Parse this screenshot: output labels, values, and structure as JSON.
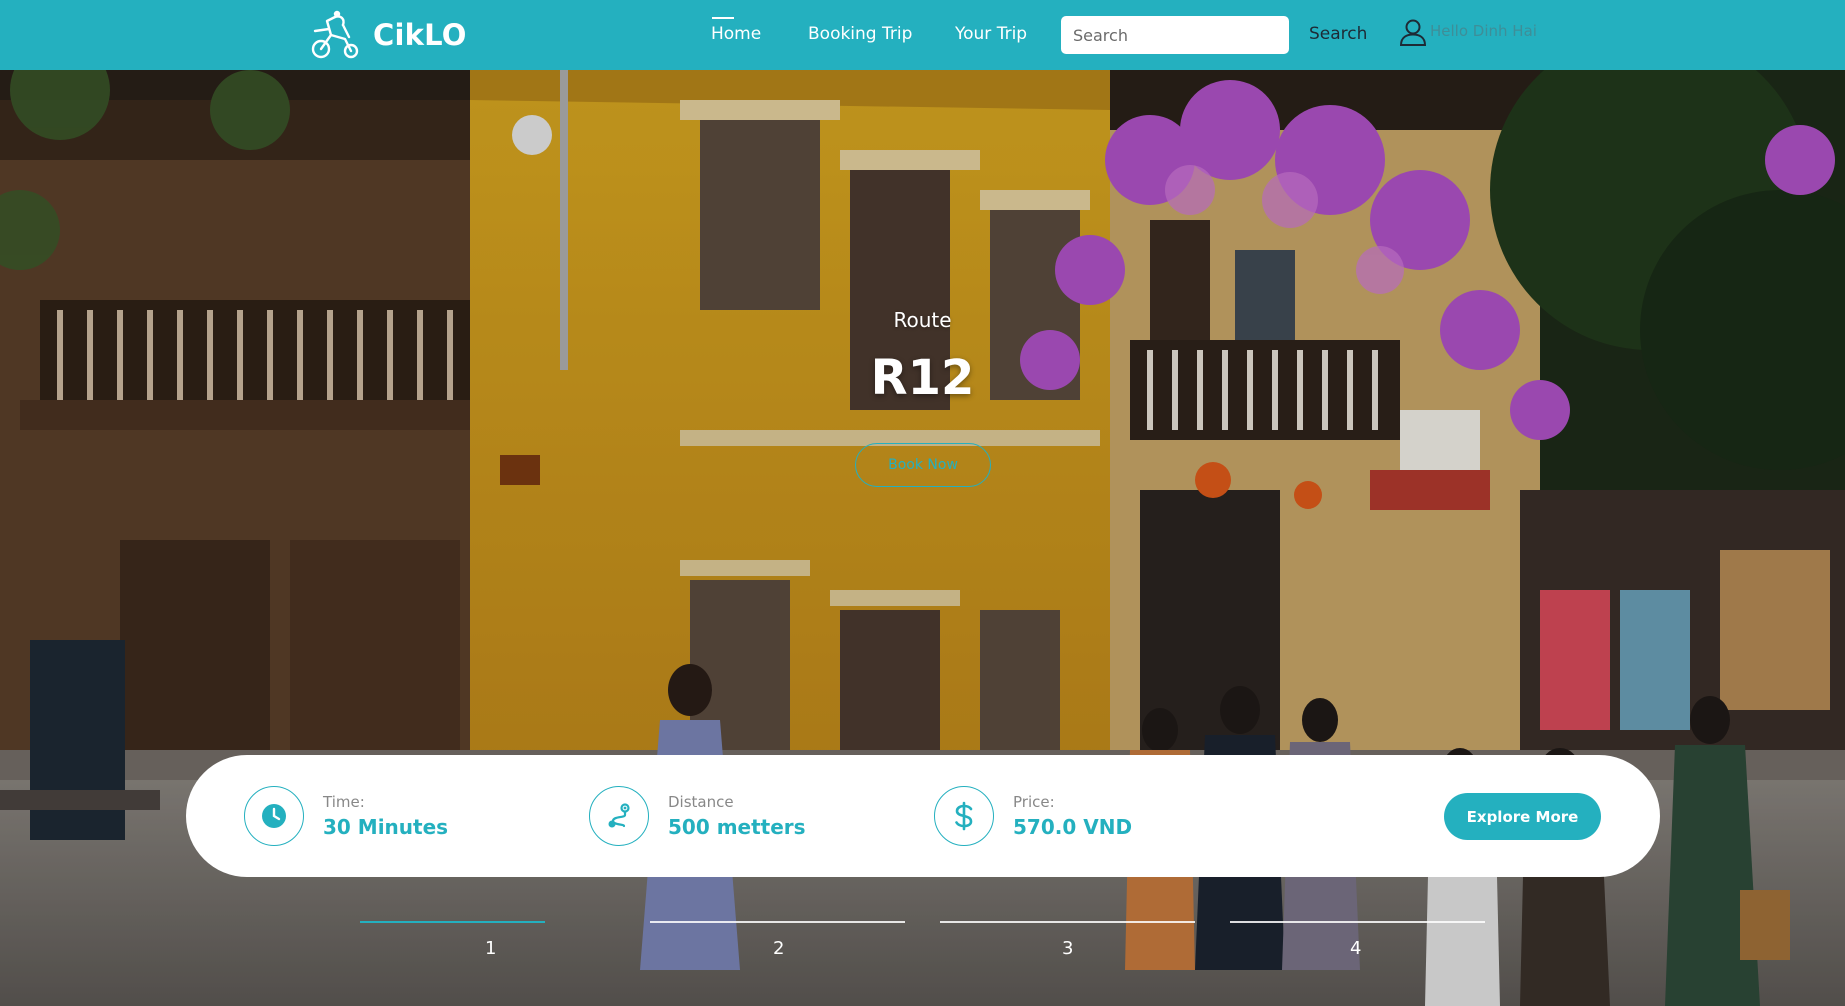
{
  "brand": {
    "name": "CikLO"
  },
  "nav": {
    "home": "Home",
    "booking": "Booking Trip",
    "your_trip": "Your Trip"
  },
  "search": {
    "placeholder": "Search",
    "button": "Search"
  },
  "user": {
    "greeting": "Hello Dinh Hai"
  },
  "hero": {
    "subtitle": "Route",
    "title": "R12",
    "book_label": "Book Now"
  },
  "info": {
    "time_label": "Time:",
    "time_value": "30 Minutes",
    "distance_label": "Distance",
    "distance_value": "500 metters",
    "price_label": "Price:",
    "price_value": "570.0 VND",
    "explore_label": "Explore More"
  },
  "slider": {
    "pages": [
      "1",
      "2",
      "3",
      "4"
    ],
    "active_index": 0
  },
  "colors": {
    "accent": "#24b0bf",
    "text_dark": "#1e2a35"
  },
  "icons": {
    "logo": "cyclo-rider-icon",
    "user": "user-icon",
    "time": "clock-icon",
    "distance": "route-icon",
    "price": "dollar-icon"
  }
}
